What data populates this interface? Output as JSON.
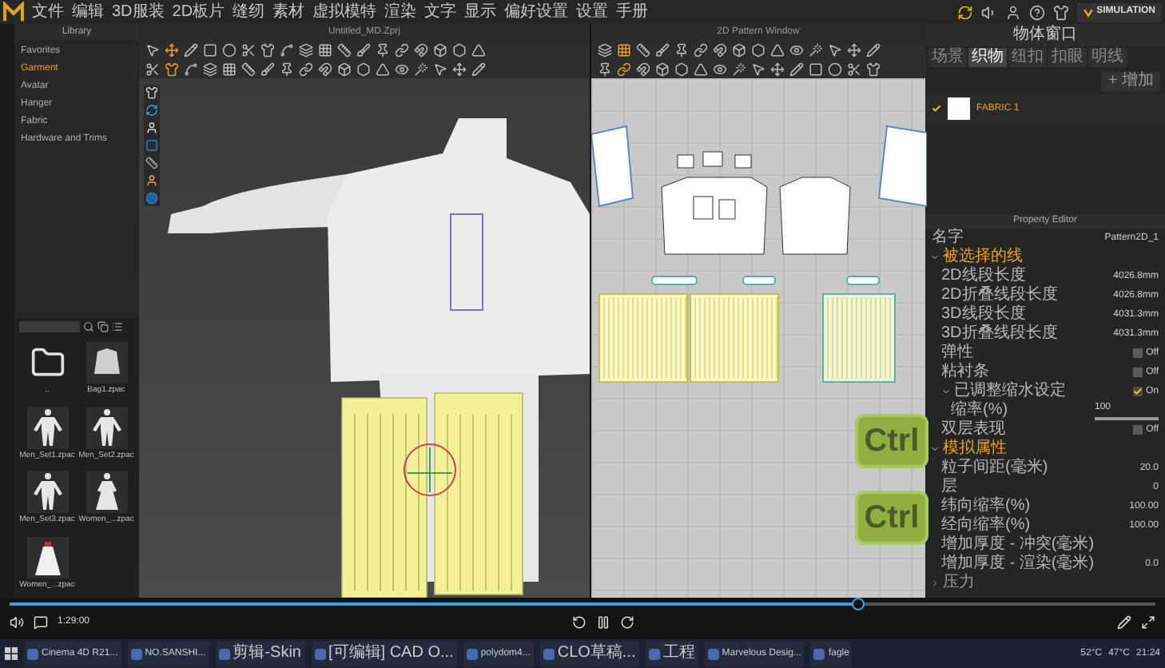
{
  "menu": [
    "文件",
    "编辑",
    "3D服装",
    "2D板片",
    "缝纫",
    "素材",
    "虚拟模特",
    "渲染",
    "文字",
    "显示",
    "偏好设置",
    "设置",
    "手册"
  ],
  "simulation": {
    "label": "SIMULATION"
  },
  "library": {
    "title": "Library",
    "categories": [
      {
        "label": "Favorites",
        "selected": false
      },
      {
        "label": "Garment",
        "selected": true
      },
      {
        "label": "Avatar",
        "selected": false
      },
      {
        "label": "Hanger",
        "selected": false
      },
      {
        "label": "Fabric",
        "selected": false
      },
      {
        "label": "Hardware and Trims",
        "selected": false
      }
    ],
    "files": [
      {
        "name": "..",
        "kind": "folder"
      },
      {
        "name": "Bag1.zpac",
        "kind": "top"
      },
      {
        "name": "Men_Set1.zpac",
        "kind": "suit"
      },
      {
        "name": "Men_Set2.zpac",
        "kind": "suit"
      },
      {
        "name": "Men_Set3.zpac",
        "kind": "suit"
      },
      {
        "name": "Women_...zpac",
        "kind": "dress"
      },
      {
        "name": "Women_...zpac",
        "kind": "gown"
      }
    ]
  },
  "viewport": {
    "title": "Untitled_MD.Zprj"
  },
  "pattern_window": {
    "title": "2D Pattern Window"
  },
  "overlay_keys": [
    "Ctrl",
    "Ctrl"
  ],
  "object_browser": {
    "title": "物体窗口",
    "tabs": [
      {
        "label": "场景",
        "selected": false
      },
      {
        "label": "织物",
        "selected": true
      },
      {
        "label": "纽扣",
        "selected": false
      },
      {
        "label": "扣眼",
        "selected": false
      },
      {
        "label": "明线",
        "selected": false
      }
    ],
    "add_button": "+ 增加",
    "fabrics": [
      {
        "name": "FABRIC 1",
        "selected": true
      }
    ]
  },
  "property_editor": {
    "title": "Property Editor",
    "name_label": "名字",
    "name_value": "Pattern2D_1",
    "sections": [
      {
        "label": "被选择的线",
        "expanded": true,
        "rows": [
          {
            "kind": "field",
            "label": "2D线段长度",
            "value": "4026.8mm"
          },
          {
            "kind": "field",
            "label": "2D折叠线段长度",
            "value": "4026.8mm"
          },
          {
            "kind": "field",
            "label": "3D线段长度",
            "value": "4031.3mm"
          },
          {
            "kind": "field",
            "label": "3D折叠线段长度",
            "value": "4031.3mm"
          },
          {
            "kind": "toggle",
            "label": "弹性",
            "checked": false,
            "value": "Off"
          },
          {
            "kind": "toggle",
            "label": "粘衬条",
            "checked": false,
            "value": "Off"
          },
          {
            "kind": "toggle",
            "label": "已调整缩水设定",
            "checked": true,
            "value": "On",
            "expanded": true,
            "rows": [
              {
                "kind": "slider",
                "label": "缩率(%)",
                "value": "100",
                "level": 1
              }
            ]
          },
          {
            "kind": "toggle",
            "label": "双层表现",
            "checked": false,
            "value": "Off"
          }
        ]
      },
      {
        "label": "模拟属性",
        "expanded": true,
        "rows": [
          {
            "kind": "field",
            "label": "粒子间距(毫米)",
            "value": "20.0"
          },
          {
            "kind": "field",
            "label": "层",
            "value": "0"
          },
          {
            "kind": "field",
            "label": "纬向缩率(%)",
            "value": "100.00"
          },
          {
            "kind": "field",
            "label": "经向缩率(%)",
            "value": "100.00"
          },
          {
            "kind": "field",
            "label": "增加厚度 - 冲突(毫米)"
          },
          {
            "kind": "field",
            "label": "增加厚度 - 渲染(毫米)",
            "value": "0.0"
          }
        ]
      },
      {
        "label": "压力",
        "expanded": false
      }
    ]
  },
  "player": {
    "time": "1:29:00",
    "level": 0.74
  },
  "taskbar": {
    "items": [
      {
        "label": "Cinema 4D R21..."
      },
      {
        "label": "NO.SANSHI..."
      },
      {
        "label": "剪辑-Skin"
      },
      {
        "label": "[可编辑] CAD O..."
      },
      {
        "label": "polydom4..."
      },
      {
        "label": "CLO草稿..."
      },
      {
        "label": "工程"
      },
      {
        "label": "Marvelous Desig..."
      },
      {
        "label": "fagle"
      }
    ],
    "temps": [
      "52°C",
      "47°C"
    ],
    "clock": "21:24"
  }
}
